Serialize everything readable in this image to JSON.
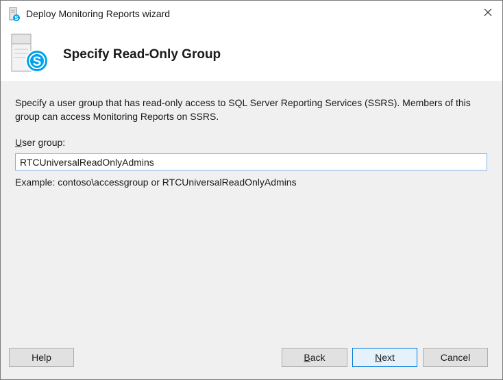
{
  "window": {
    "title": "Deploy Monitoring Reports wizard",
    "close_glyph": "✕",
    "title_icon": "server-skype-icon"
  },
  "header": {
    "title": "Specify Read-Only Group",
    "icon": "skype-server-logo-icon"
  },
  "content": {
    "description_line1": "Specify a user group that has read-only access to SQL Server Reporting Services (SSRS). Members of this",
    "description_line2": "group can access Monitoring Reports on SSRS.",
    "field_label_accel": "U",
    "field_label_rest": "ser group:",
    "user_group_value": "RTCUniversalReadOnlyAdmins",
    "example": "Example: contoso\\accessgroup or RTCUniversalReadOnlyAdmins"
  },
  "buttons": {
    "help": "Help",
    "back_accel": "B",
    "back_rest": "ack",
    "next_accel": "N",
    "next_rest": "ext",
    "cancel": "Cancel"
  },
  "colors": {
    "skype_blue": "#00a2ed",
    "focus_border": "#0078d7",
    "input_border": "#7eb4ea"
  }
}
